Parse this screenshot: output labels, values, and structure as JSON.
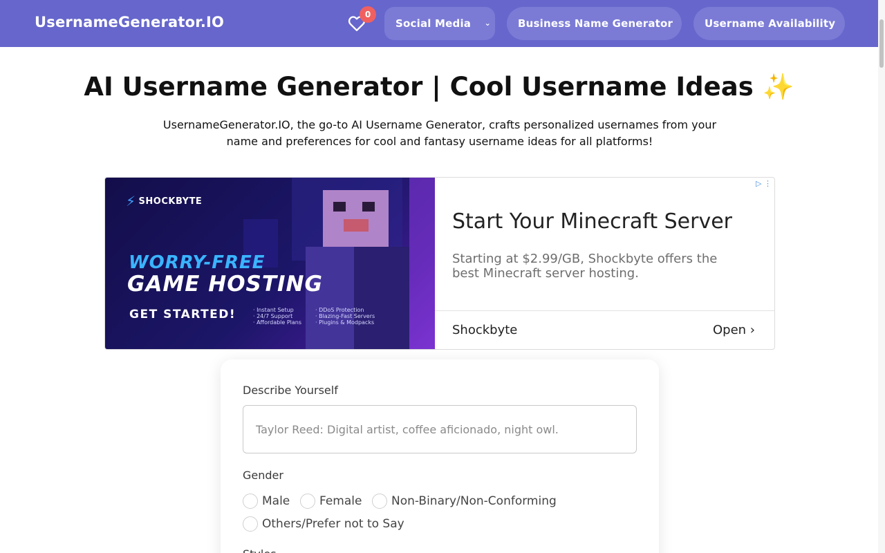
{
  "header": {
    "brand": "UsernameGenerator.IO",
    "favorites_count": "0",
    "nav": {
      "social_media": "Social Media",
      "business_name": "Business Name Generator",
      "username_availability": "Username Availability"
    },
    "bg_color": "#6666cc"
  },
  "hero": {
    "title": "AI Username Generator | Cool Username Ideas ✨",
    "description": "UsernameGenerator.IO, the go-to AI Username Generator, crafts personalized usernames from your name and preferences for cool and fantasy username ideas for all platforms!"
  },
  "ad": {
    "image": {
      "logo": "SHOCKBYTE",
      "headline_1": "WORRY-FREE",
      "headline_2": "GAME HOSTING",
      "cta": "GET STARTED!",
      "features_left": [
        "· Instant Setup",
        "· 24/7 Support",
        "· Affordable Plans"
      ],
      "features_right": [
        "· DDoS Protection",
        "· Blazing-Fast Servers",
        "· Plugins & Modpacks"
      ]
    },
    "title": "Start Your Minecraft Server",
    "subtitle": "Starting at $2.99/GB, Shockbyte offers the best Minecraft server hosting.",
    "advertiser": "Shockbyte",
    "open_label": "Open"
  },
  "form": {
    "describe_label": "Describe Yourself",
    "describe_placeholder": "Taylor Reed: Digital artist, coffee aficionado, night owl.",
    "gender_label": "Gender",
    "gender_options": [
      "Male",
      "Female",
      "Non-Binary/Non-Conforming",
      "Others/Prefer not to Say"
    ],
    "styles_label": "Styles"
  }
}
